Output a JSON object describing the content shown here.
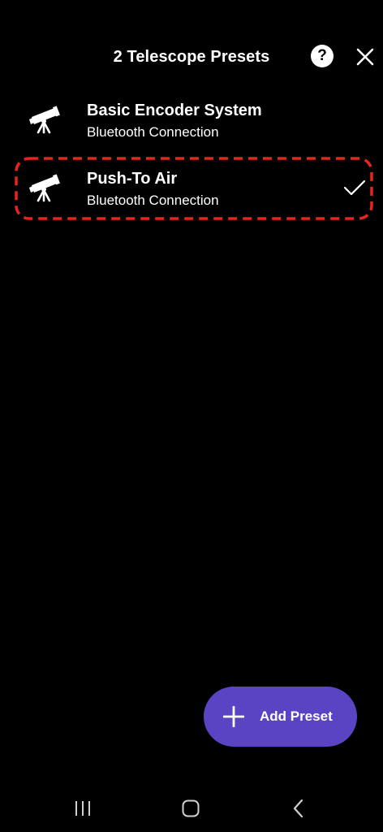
{
  "header": {
    "title": "2 Telescope Presets"
  },
  "icons": {
    "help": "help-icon",
    "close": "close-icon",
    "telescope": "telescope-icon",
    "check": "check-icon",
    "plus": "plus-icon"
  },
  "presets": [
    {
      "name": "Basic Encoder System",
      "connection": "Bluetooth Connection",
      "selected": false
    },
    {
      "name": "Push-To Air",
      "connection": "Bluetooth Connection",
      "selected": true
    }
  ],
  "highlight": {
    "color": "#e4261d",
    "style": "dashed"
  },
  "add_button": {
    "label": "Add Preset",
    "color": "#5b44c4"
  },
  "nav_bar": {
    "items": [
      "recents",
      "home",
      "back"
    ]
  }
}
